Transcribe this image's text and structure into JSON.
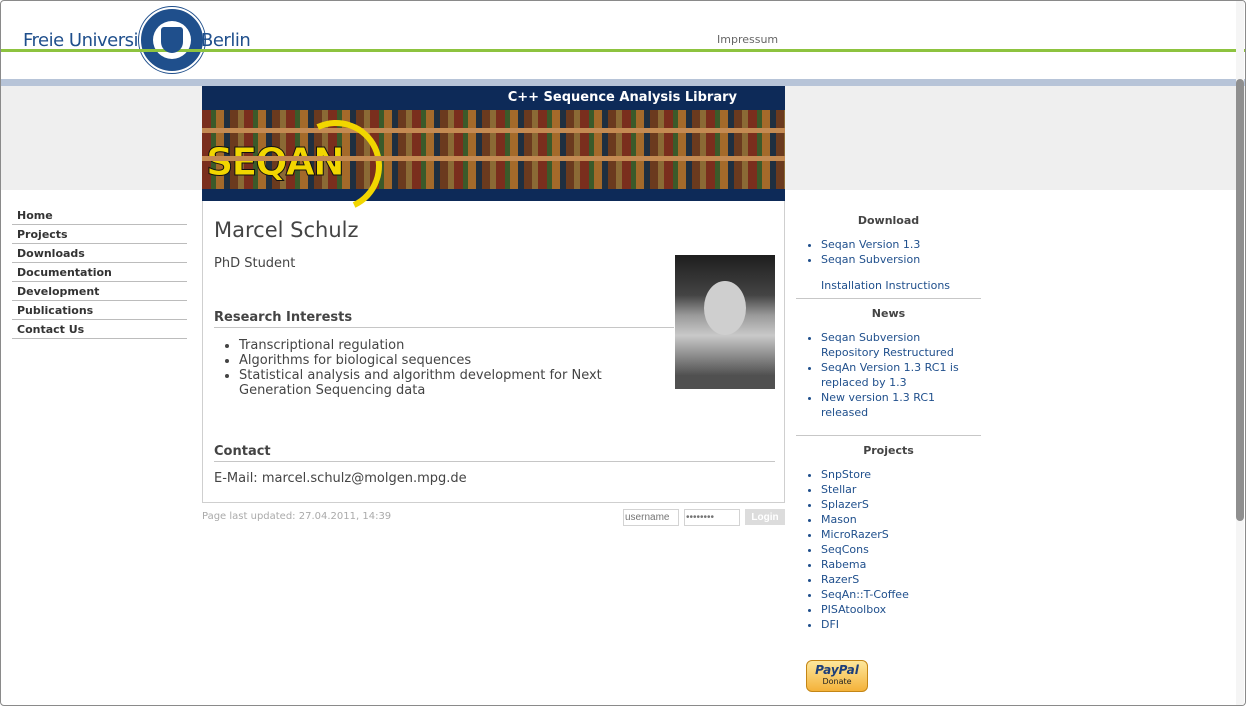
{
  "header": {
    "university_left": "Freie Universität",
    "university_right": "Berlin",
    "impressum": "Impressum"
  },
  "banner": {
    "title": "C++ Sequence Analysis Library",
    "logo_text": "SEQAN"
  },
  "nav": [
    "Home",
    "Projects",
    "Downloads",
    "Documentation",
    "Development",
    "Publications",
    "Contact Us"
  ],
  "profile": {
    "name": "Marcel Schulz",
    "role": "PhD Student",
    "research_heading": "Research Interests",
    "research_items": [
      "Transcriptional regulation",
      "Algorithms for biological sequences",
      "Statistical analysis and algorithm development for Next Generation Sequencing data"
    ],
    "contact_heading": "Contact",
    "email": "E-Mail: marcel.schulz@molgen.mpg.de"
  },
  "footer": {
    "updated": "Page last updated: 27.04.2011, 14:39",
    "username_placeholder": "username",
    "password_placeholder": "••••••••",
    "login": "Login"
  },
  "sidebar": {
    "download_heading": "Download",
    "download_items": [
      "Seqan Version 1.3",
      "Seqan Subversion"
    ],
    "install": "Installation Instructions",
    "news_heading": "News",
    "news_items": [
      "Seqan Subversion Repository Restructured",
      "SeqAn Version 1.3 RC1 is replaced by 1.3",
      "New version 1.3 RC1 released"
    ],
    "projects_heading": "Projects",
    "projects": [
      "SnpStore",
      "Stellar",
      "SplazerS",
      "Mason",
      "MicroRazerS",
      "SeqCons",
      "Rabema",
      "RazerS",
      "SeqAn::T-Coffee",
      "PISAtoolbox",
      "DFI"
    ],
    "paypal_main": "PayPal",
    "paypal_sub": "Donate"
  },
  "colors": {
    "green_bar": "#8dc33f",
    "blue_bar": "#b7c4d8",
    "link": "#1f4f8c",
    "banner": "#0d2a58"
  }
}
